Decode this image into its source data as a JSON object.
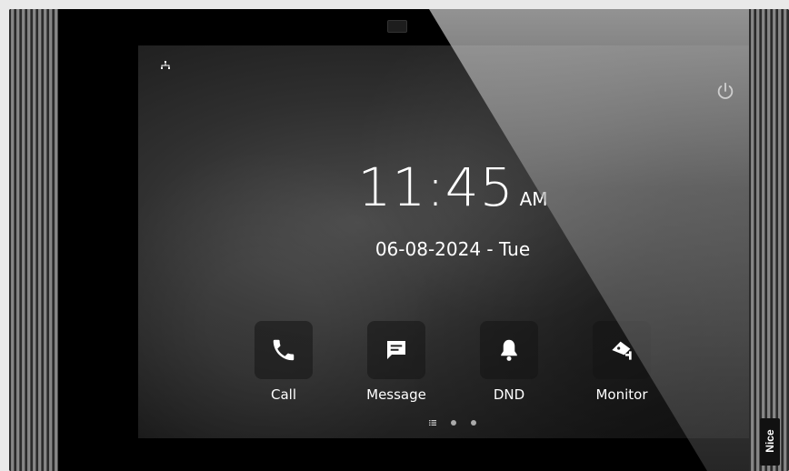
{
  "clock": {
    "time": "11:45",
    "ampm": "AM"
  },
  "date": "06-08-2024 - Tue",
  "tiles": [
    {
      "label": "Call",
      "icon": "phone-icon"
    },
    {
      "label": "Message",
      "icon": "message-icon"
    },
    {
      "label": "DND",
      "icon": "bell-icon"
    },
    {
      "label": "Monitor",
      "icon": "camera-icon"
    }
  ],
  "status": {
    "network_icon": "network-icon",
    "power_icon": "power-icon"
  },
  "page_indicator": {
    "pages": 3
  },
  "brand": "Nice"
}
